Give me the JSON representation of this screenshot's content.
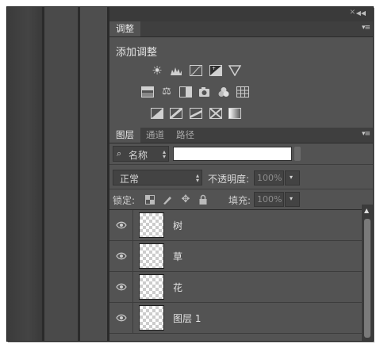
{
  "adjustments_panel": {
    "tab": "调整",
    "heading": "添加调整",
    "icons": [
      [
        "brightness-icon",
        "levels-icon",
        "curves-icon",
        "exposure-icon",
        "vibrance-icon"
      ],
      [
        "hue-saturation-icon",
        "color-balance-icon",
        "black-white-icon",
        "photo-filter-icon",
        "channel-mixer-icon",
        "color-lookup-icon"
      ],
      [
        "invert-icon",
        "posterize-icon",
        "threshold-icon",
        "selective-color-icon",
        "gradient-map-icon"
      ]
    ]
  },
  "layers_panel": {
    "tabs": [
      "图层",
      "通道",
      "路径"
    ],
    "filter": {
      "kind_label": "名称",
      "search_value": ""
    },
    "blend_mode": "正常",
    "opacity_label": "不透明度:",
    "opacity_value": "100%",
    "lock_label": "锁定:",
    "fill_label": "填充:",
    "fill_value": "100%",
    "layers": [
      {
        "name": "树",
        "visible": true
      },
      {
        "name": "草",
        "visible": true
      },
      {
        "name": "花",
        "visible": true
      },
      {
        "name": "图层 1",
        "visible": true
      }
    ]
  }
}
